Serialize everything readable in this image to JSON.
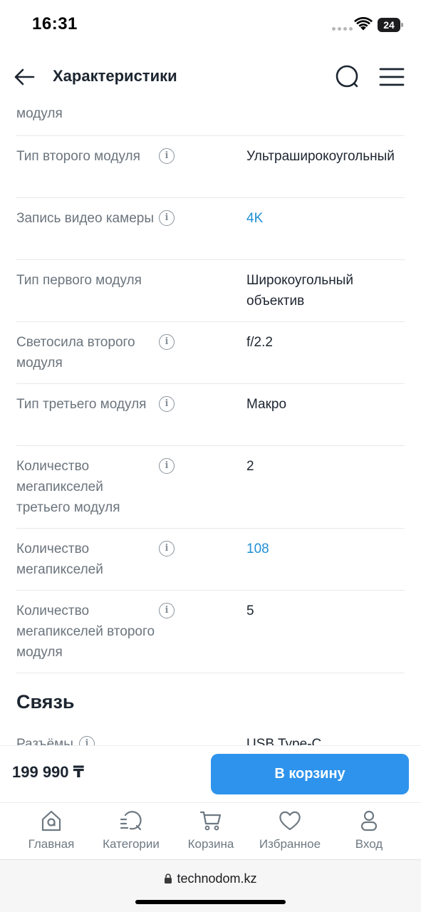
{
  "status_bar": {
    "time": "16:31",
    "battery": "24"
  },
  "header": {
    "title": "Характеристики"
  },
  "specs": [
    {
      "label": "модуля",
      "info": false,
      "value": "",
      "link": false
    },
    {
      "label": "Тип второго модуля",
      "info": true,
      "value": "Ультраширокоугольный",
      "link": false
    },
    {
      "label": "Запись видео камеры",
      "info": true,
      "value": "4K",
      "link": true
    },
    {
      "label": "Тип первого модуля",
      "info": false,
      "value": "Широкоугольный объектив",
      "link": false
    },
    {
      "label": "Светосила второго модуля",
      "info": true,
      "value": "f/2.2",
      "link": false
    },
    {
      "label": "Тип третьего модуля",
      "info": true,
      "value": "Макро",
      "link": false
    },
    {
      "label": "Количество мегапикселей третьего модуля",
      "info": true,
      "value": "2",
      "link": false
    },
    {
      "label": "Количество мегапикселей",
      "info": true,
      "value": "108",
      "link": true
    },
    {
      "label": "Количество мегапикселей второго модуля",
      "info": true,
      "value": "5",
      "link": false
    }
  ],
  "section": {
    "title": "Связь"
  },
  "partial_row": {
    "label": "Разъёмы",
    "value": "USB Type-C"
  },
  "buy_bar": {
    "price": "199 990 ₸",
    "cart_button": "В корзину"
  },
  "bottom_nav": [
    {
      "label": "Главная",
      "icon": "home-icon"
    },
    {
      "label": "Категории",
      "icon": "catalog-search-icon"
    },
    {
      "label": "Корзина",
      "icon": "cart-icon"
    },
    {
      "label": "Избранное",
      "icon": "heart-icon"
    },
    {
      "label": "Вход",
      "icon": "user-icon"
    }
  ],
  "browser": {
    "url": "technodom.kz"
  },
  "colors": {
    "accent": "#2e93ec",
    "link": "#1f8fd6",
    "label": "#6b747d",
    "text": "#1c2530"
  }
}
